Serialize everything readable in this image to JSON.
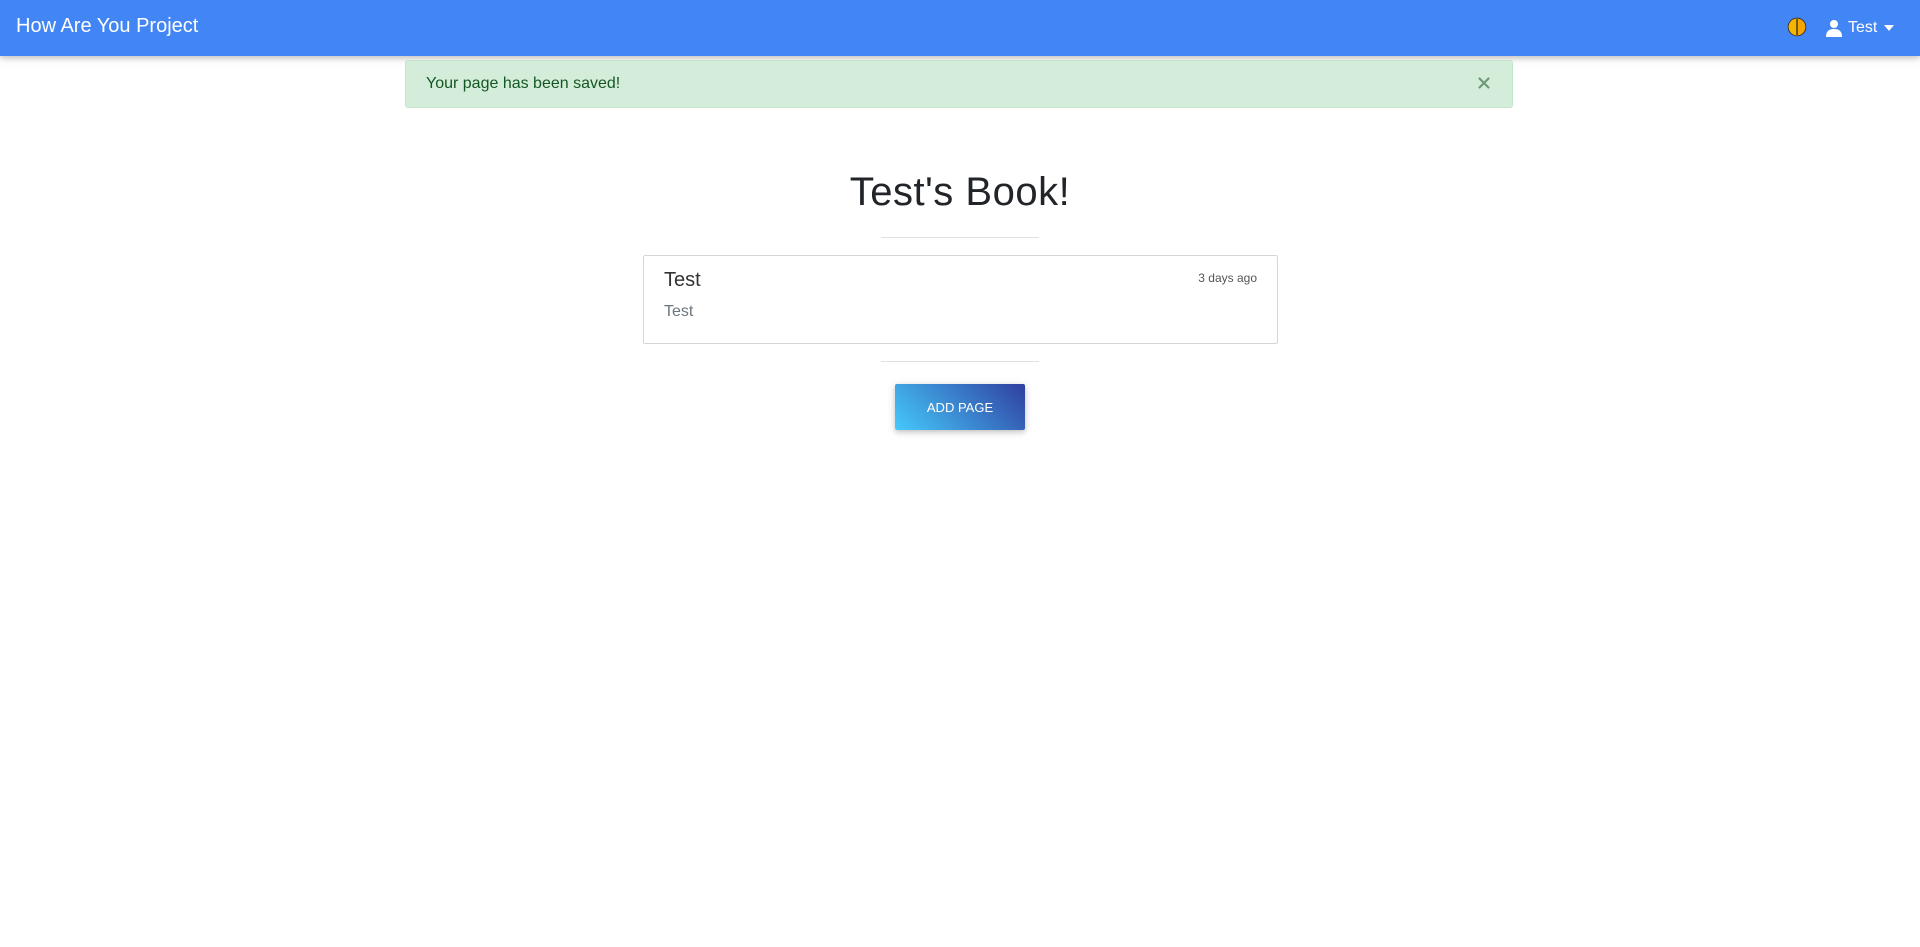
{
  "navbar": {
    "brand": "How Are You Project",
    "theme_icon": "half-moon-icon",
    "user_icon": "user-icon",
    "user_name": "Test",
    "accent": "#4285f4"
  },
  "alert": {
    "message": "Your page has been saved!",
    "close_icon": "close-icon",
    "background": "#d4edda"
  },
  "book": {
    "title": "Test's Book!"
  },
  "pages": [
    {
      "title": "Test",
      "time": "3 days ago",
      "body": "Test"
    }
  ],
  "actions": {
    "add_page_label": "ADD PAGE"
  }
}
